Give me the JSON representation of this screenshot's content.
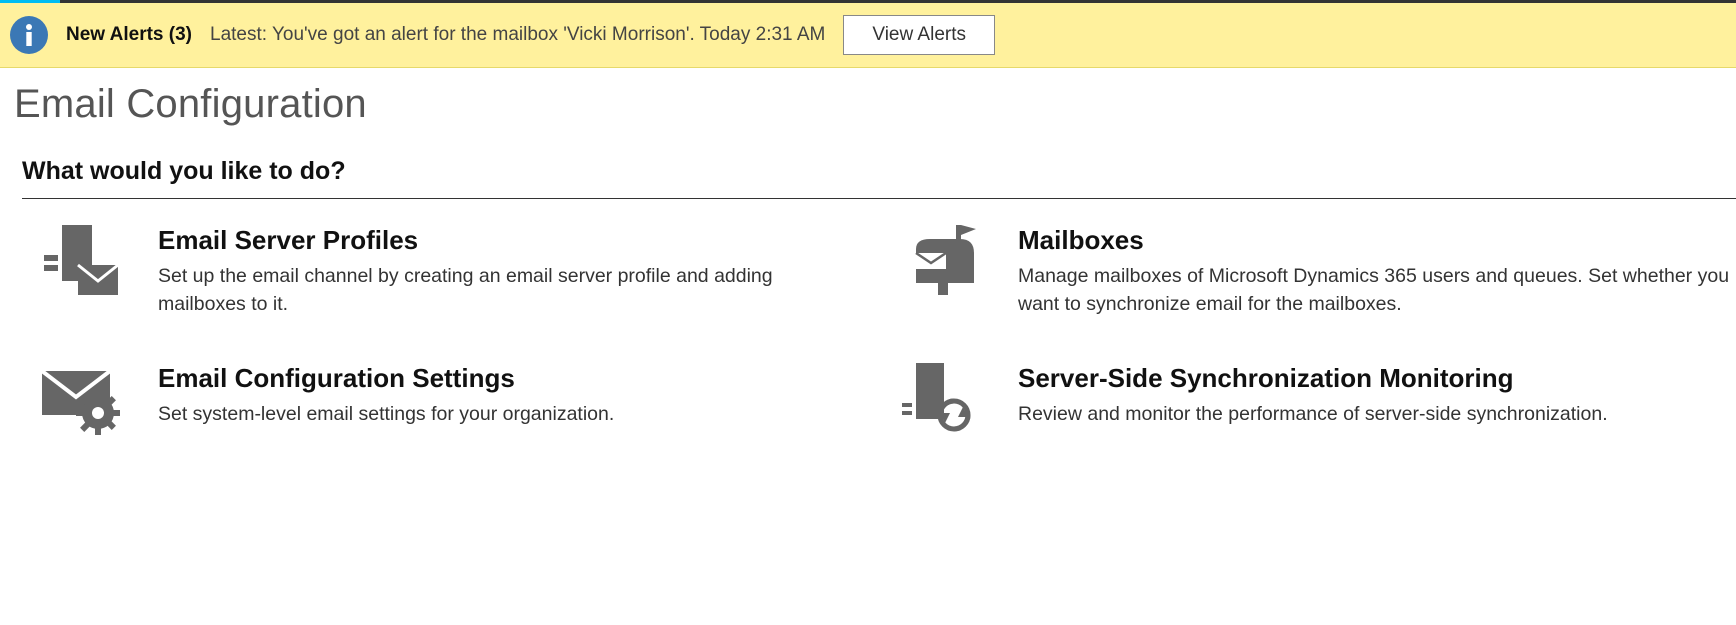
{
  "alertBar": {
    "title": "New Alerts (3)",
    "latest": "Latest: You've got an alert for the mailbox 'Vicki Morrison'. Today 2:31 AM",
    "viewButton": "View Alerts"
  },
  "page": {
    "title": "Email Configuration",
    "sectionTitle": "What would you like to do?"
  },
  "options": [
    {
      "title": "Email Server Profiles",
      "desc": "Set up the email channel by creating an email server profile and adding mailboxes to it."
    },
    {
      "title": "Mailboxes",
      "desc": "Manage mailboxes of Microsoft Dynamics 365 users and queues. Set whether you want to synchronize email for the mailboxes."
    },
    {
      "title": "Email Configuration Settings",
      "desc": "Set system-level email settings for your organization."
    },
    {
      "title": "Server-Side Synchronization Monitoring",
      "desc": "Review and monitor the performance of server-side synchronization."
    }
  ]
}
